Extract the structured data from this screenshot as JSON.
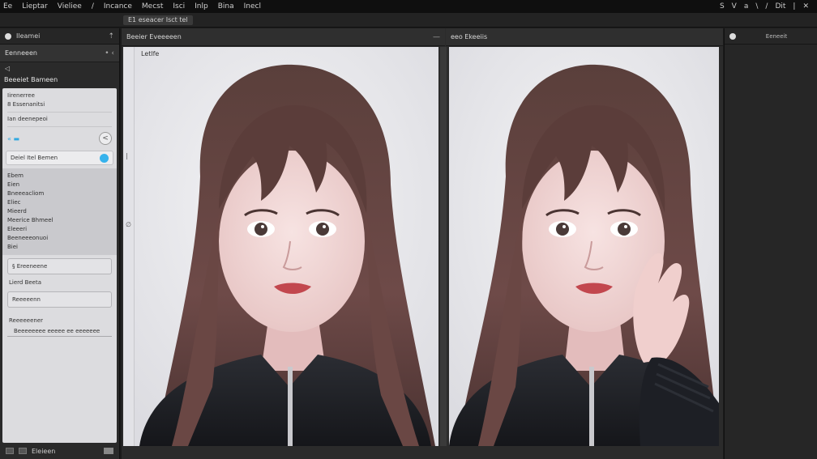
{
  "menubar": {
    "items": [
      "Ee",
      "Lieptar",
      "Vieliee",
      "/",
      "Incance",
      "Mecst",
      "Isci",
      "Inlp",
      "Bina",
      "Inecl"
    ],
    "right_items": [
      "S",
      "V",
      "a",
      "\\",
      "/",
      "Dit",
      "|",
      "✕"
    ]
  },
  "pathbar": {
    "path": "E1 eseacer Isct tel"
  },
  "left_panel": {
    "header_label": "Ileamei",
    "header_tail": "⇡",
    "layer_label": "Eenneeen",
    "layer_tail": "• ‹",
    "small_row": "◁",
    "section_label": "Beeeiet Bameen",
    "props_lines_top": [
      "Iirenerree",
      "8 Essenanitsi"
    ],
    "props_line_2": "Ian deenepeoi",
    "toggle_label": "« ▬",
    "toggle_btn": "<",
    "field_label": "Deiel Itel Bemen",
    "list_items": [
      "Ebem",
      "Eien",
      "Bneeeacliom",
      "Eliec",
      "Mieerd",
      "Meerice Bhmeel",
      "Eleeeri",
      "Beeneeeonuoi",
      "Biei"
    ],
    "box_field_1": "§ Ereeneene",
    "plain_1": "Lierd Beeta",
    "box_field_2": "Reeeeenn",
    "plain_2": "Reeeeeener",
    "underline_text": "Beeeeeeee eeeee ee eeeeeee",
    "footer_label": "Eleieen"
  },
  "viewer": {
    "left_header": "Beeier Eveeeeen",
    "left_header_tail": "—",
    "right_header": "eeo Ekeeiis",
    "left_canvas_label": "Letlfe",
    "ruler_marks": [
      "|",
      "∅"
    ]
  },
  "right_panel": {
    "header_label": "Eeneeit"
  },
  "colors": {
    "accent": "#36b2ec",
    "panel_bg": "#2a2a2a",
    "canvas_bg": "#e9e9ed"
  }
}
